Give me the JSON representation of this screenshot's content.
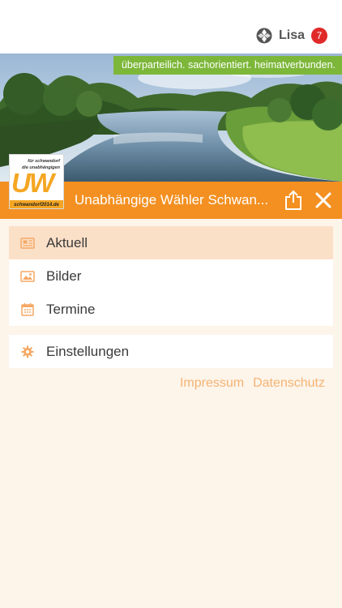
{
  "header": {
    "user_name": "Lisa",
    "badge_count": "7"
  },
  "hero": {
    "tagline": "überparteilich. sachorientiert. heimatverbunden."
  },
  "logo": {
    "line1": "für schwandorf",
    "line2": "die unabhängigen",
    "mark": "UW",
    "url": "schwandorf2014.de"
  },
  "titlebar": {
    "title": "Unabhängige Wähler Schwan..."
  },
  "menu": {
    "items": [
      {
        "label": "Aktuell",
        "icon": "newspaper-icon",
        "active": true
      },
      {
        "label": "Bilder",
        "icon": "image-icon"
      },
      {
        "label": "Termine",
        "icon": "calendar-icon"
      }
    ],
    "settings_label": "Einstellungen"
  },
  "footer": {
    "impressum": "Impressum",
    "datenschutz": "Datenschutz"
  },
  "colors": {
    "accent": "#f39021",
    "active_bg": "#fbe0c8",
    "page_bg": "#fdf4ea",
    "tagline_bg": "#7db73a",
    "badge": "#e02a2a",
    "footer_link": "#f5b474",
    "icon": "#f5a864"
  }
}
